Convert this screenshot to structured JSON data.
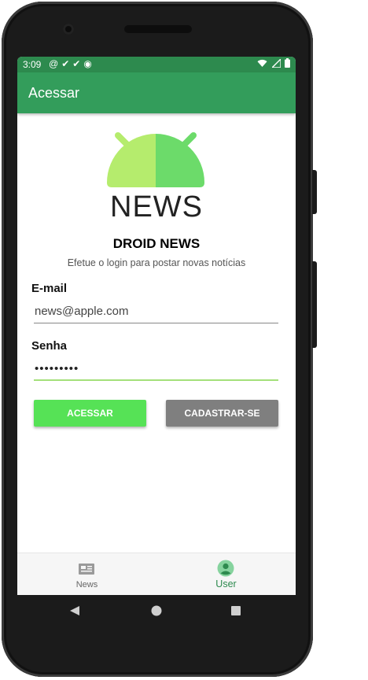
{
  "status": {
    "time": "3:09",
    "left_icons": [
      "at-icon",
      "check-icon",
      "check-icon",
      "chrome-icon"
    ],
    "right_icons": [
      "wifi-icon",
      "signal-icon",
      "battery-icon"
    ]
  },
  "appbar": {
    "title": "Acessar"
  },
  "logo": {
    "word": "NEWS",
    "colors": {
      "left": "#b5ec6d",
      "right": "#6cdb6a"
    }
  },
  "app_name": "DROID NEWS",
  "subtitle": "Efetue o login para postar novas notícias",
  "form": {
    "email_label": "E-mail",
    "email_value": "news@apple.com",
    "password_label": "Senha",
    "password_value": "•••••••••"
  },
  "buttons": {
    "login": "ACESSAR",
    "register": "CADASTRAR-SE"
  },
  "bottom_nav": {
    "items": [
      {
        "label": "News",
        "icon": "newspaper-icon",
        "active": false
      },
      {
        "label": "User",
        "icon": "user-icon",
        "active": true
      }
    ]
  },
  "colors": {
    "status_bar": "#2d8a4e",
    "app_bar": "#339d5b",
    "login_button": "#56e256",
    "register_button": "#7f7f7f",
    "active_nav": "#2d8a4e"
  }
}
